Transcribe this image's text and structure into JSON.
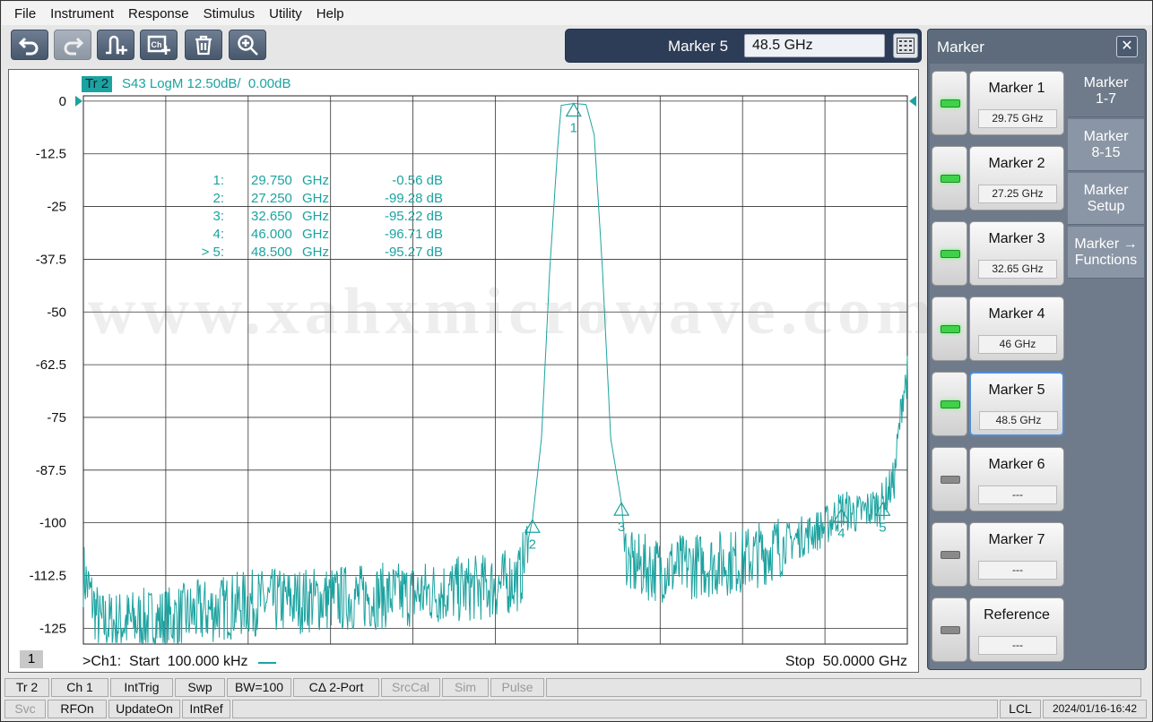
{
  "menu": [
    "File",
    "Instrument",
    "Response",
    "Stimulus",
    "Utility",
    "Help"
  ],
  "toolbar": {
    "buttons": [
      {
        "name": "undo-icon"
      },
      {
        "name": "redo-icon"
      },
      {
        "name": "marker-add-icon"
      },
      {
        "name": "channel-add-icon"
      },
      {
        "name": "trash-icon"
      },
      {
        "name": "zoom-icon"
      }
    ],
    "entry_label": "Marker 5",
    "entry_value": "48.5 GHz"
  },
  "plot": {
    "trace_tag": "Tr 2",
    "trace_title": "S43 LogM 12.50dB/  0.00dB",
    "watermark": "www.xahxmicrowave.com",
    "channel_number": "1",
    "start_label": ">Ch1:  Start  100.000 kHz",
    "stop_label": "Stop  50.0000 GHz",
    "y_ticks": [
      "0",
      "-12.5",
      "-25",
      "-37.5",
      "-50",
      "-62.5",
      "-75",
      "-87.5",
      "-100",
      "-112.5",
      "-125"
    ],
    "marker_table": [
      {
        "id": "1:",
        "freq": "29.750",
        "unit": "GHz",
        "value": "-0.56 dB"
      },
      {
        "id": "2:",
        "freq": "27.250",
        "unit": "GHz",
        "value": "-99.28 dB"
      },
      {
        "id": "3:",
        "freq": "32.650",
        "unit": "GHz",
        "value": "-95.22 dB"
      },
      {
        "id": "4:",
        "freq": "46.000",
        "unit": "GHz",
        "value": "-96.71 dB"
      },
      {
        "id": "> 5:",
        "freq": "48.500",
        "unit": "GHz",
        "value": "-95.27 dB"
      }
    ],
    "trace_color": "#1ca3a0"
  },
  "chart_data": {
    "type": "line",
    "title": "S43 LogM 12.50dB/  0.00dB",
    "xlabel": "",
    "ylabel": "",
    "xlim": [
      0.0001,
      50
    ],
    "ylim": [
      -128.75,
      1.25
    ],
    "grid": true,
    "series": [
      {
        "name": "Tr 2",
        "x": [
          0.0001,
          1,
          5,
          10,
          15,
          20,
          25,
          26.5,
          27.25,
          27.8,
          28.3,
          28.8,
          29.0,
          29.75,
          30.5,
          31.0,
          31.5,
          32.0,
          32.65,
          33.0,
          35,
          40,
          45,
          46,
          47,
          48.5,
          49.2,
          49.7,
          50
        ],
        "values": [
          -112,
          -124,
          -123,
          -119,
          -118,
          -117,
          -115,
          -113,
          -99.28,
          -80,
          -40,
          -10,
          -1,
          -0.56,
          -0.8,
          -8,
          -40,
          -80,
          -95.22,
          -110,
          -111,
          -109,
          -101,
          -96.71,
          -98,
          -95.27,
          -90,
          -70,
          -65
        ]
      }
    ],
    "markers": [
      {
        "label": "1",
        "x": 29.75,
        "y": -0.56
      },
      {
        "label": "2",
        "x": 27.25,
        "y": -99.28
      },
      {
        "label": "3",
        "x": 32.65,
        "y": -95.22
      },
      {
        "label": "4",
        "x": 46.0,
        "y": -96.71
      },
      {
        "label": "5",
        "x": 48.5,
        "y": -95.27
      }
    ]
  },
  "marker_panel": {
    "title": "Marker",
    "close": "✕",
    "markers": [
      {
        "label": "Marker 1",
        "value": "29.75 GHz",
        "on": true
      },
      {
        "label": "Marker 2",
        "value": "27.25 GHz",
        "on": true
      },
      {
        "label": "Marker 3",
        "value": "32.65 GHz",
        "on": true
      },
      {
        "label": "Marker 4",
        "value": "46 GHz",
        "on": true
      },
      {
        "label": "Marker 5",
        "value": "48.5 GHz",
        "on": true
      },
      {
        "label": "Marker 6",
        "value": "---",
        "on": false
      },
      {
        "label": "Marker 7",
        "value": "---",
        "on": false
      },
      {
        "label": "Reference",
        "value": "---",
        "on": false
      }
    ],
    "tabs": [
      "Marker\n1-7",
      "Marker\n8-15",
      "Marker\nSetup",
      "Marker →\nFunctions"
    ]
  },
  "status_row1": [
    {
      "label": "Tr 2",
      "dim": false
    },
    {
      "label": "Ch 1",
      "dim": false
    },
    {
      "label": "IntTrig",
      "dim": false
    },
    {
      "label": "Swp",
      "dim": false
    },
    {
      "label": "BW=100",
      "dim": false
    },
    {
      "label": "CΔ 2-Port",
      "dim": false
    },
    {
      "label": "SrcCal",
      "dim": true
    },
    {
      "label": "Sim",
      "dim": true
    },
    {
      "label": "Pulse",
      "dim": true
    }
  ],
  "status_row2": [
    {
      "label": "Svc",
      "dim": true
    },
    {
      "label": "RFOn",
      "dim": false
    },
    {
      "label": "UpdateOn",
      "dim": false
    },
    {
      "label": "IntRef",
      "dim": false
    }
  ],
  "status_right": {
    "lcl": "LCL",
    "datetime": "2024/01/16-16:42"
  }
}
